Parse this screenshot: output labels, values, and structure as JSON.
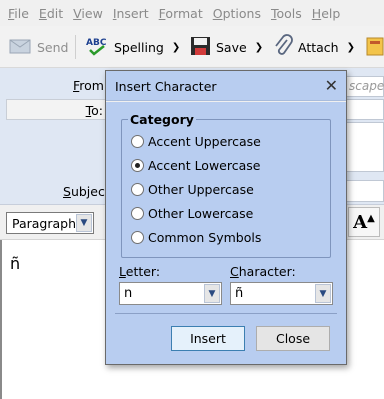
{
  "menu": [
    "File",
    "Edit",
    "View",
    "Insert",
    "Format",
    "Options",
    "Tools",
    "Help"
  ],
  "toolbar": {
    "send": "Send",
    "spelling": "Spelling",
    "save": "Save",
    "attach": "Attach"
  },
  "header": {
    "from_label": "From:",
    "from_placeholder_partial": "scape",
    "to_label": "To:",
    "subject_label": "Subject:"
  },
  "format": {
    "paragraph_style": "Paragraph"
  },
  "body": {
    "text": "ñ"
  },
  "dialog": {
    "title": "Insert Character",
    "category_label": "Category",
    "categories": [
      {
        "label": "Accent Uppercase",
        "checked": false
      },
      {
        "label": "Accent Lowercase",
        "checked": true
      },
      {
        "label": "Other Uppercase",
        "checked": false
      },
      {
        "label": "Other Lowercase",
        "checked": false
      },
      {
        "label": "Common Symbols",
        "checked": false
      }
    ],
    "letter_label": "Letter:",
    "letter_value": "n",
    "character_label": "Character:",
    "character_value": "ñ",
    "insert_button": "Insert",
    "close_button": "Close"
  }
}
